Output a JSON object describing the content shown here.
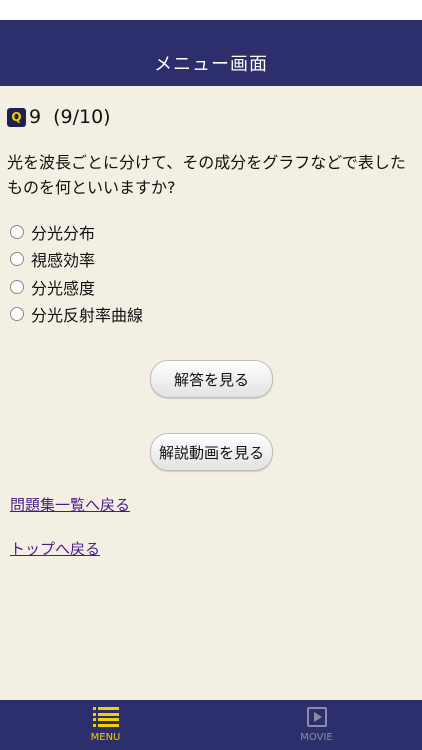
{
  "nav": {
    "title": "メニュー画面"
  },
  "question": {
    "badge": "Q",
    "number": "9",
    "progress": "(9/10)",
    "text": "光を波長ごとに分けて、その成分をグラフなどで表したものを何といいますか?"
  },
  "choices": [
    {
      "label": "分光分布"
    },
    {
      "label": "視感効率"
    },
    {
      "label": "分光感度"
    },
    {
      "label": "分光反射率曲線"
    }
  ],
  "buttons": {
    "answer": "解答を見る",
    "video": "解説動画を見る"
  },
  "links": {
    "list": "問題集一覧へ戻る",
    "top": "トップへ戻る"
  },
  "tabs": [
    {
      "label": "MENU",
      "icon": "menu-list-icon",
      "active": true
    },
    {
      "label": "MOVIE",
      "icon": "movie-play-icon",
      "active": false
    }
  ],
  "colors": {
    "nav_bg": "#2c2f6b",
    "page_bg": "#f3f0e3",
    "accent": "#f3d000",
    "link": "#4a1a8c"
  }
}
